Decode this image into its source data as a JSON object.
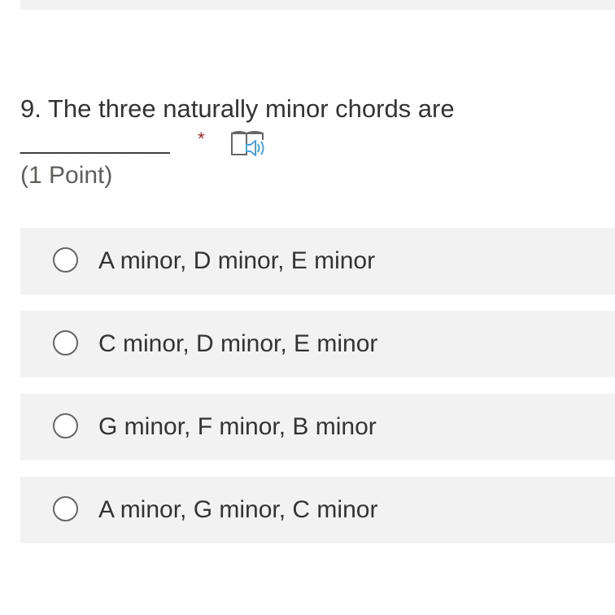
{
  "question": {
    "number": "9.",
    "text": "The three naturally minor chords are",
    "blank": "___________",
    "required_mark": "*",
    "points": "(1 Point)",
    "reader_icon": "immersive-reader-icon"
  },
  "options": [
    {
      "label": "A minor, D minor, E minor",
      "selected": false
    },
    {
      "label": "C minor, D minor, E minor",
      "selected": false
    },
    {
      "label": "G minor, F minor, B minor",
      "selected": false
    },
    {
      "label": "A minor, G minor, C minor",
      "selected": false
    }
  ],
  "colors": {
    "required": "#a4262c",
    "option_background": "#f2f2f2",
    "reader_icon_accent": "#4aa3df"
  }
}
